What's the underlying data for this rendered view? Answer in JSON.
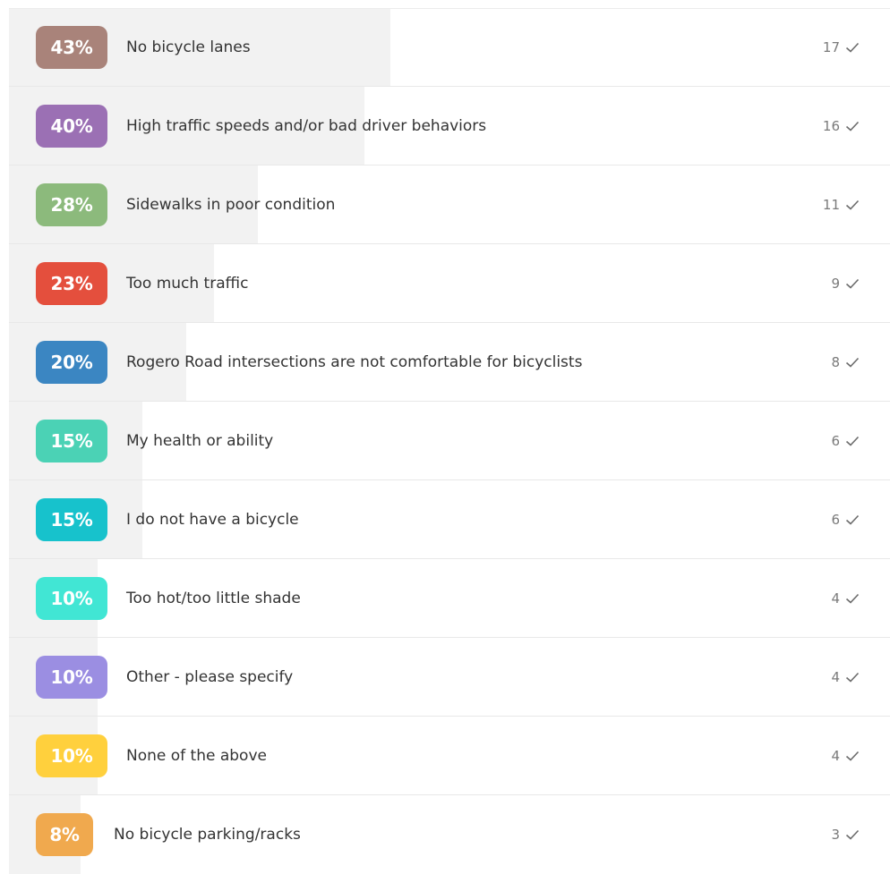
{
  "results": {
    "fill_color": "#f2f2f2",
    "items": [
      {
        "percent": "43%",
        "percent_value": 43,
        "label": "No bicycle lanes",
        "count": "17",
        "color": "#a9837a",
        "icon": "check-icon"
      },
      {
        "percent": "40%",
        "percent_value": 40,
        "label": "High traffic speeds and/or bad driver behaviors",
        "count": "16",
        "color": "#9b70b4",
        "icon": "check-icon"
      },
      {
        "percent": "28%",
        "percent_value": 28,
        "label": "Sidewalks in poor condition",
        "count": "11",
        "color": "#8cba7c",
        "icon": "check-icon"
      },
      {
        "percent": "23%",
        "percent_value": 23,
        "label": "Too much traffic",
        "count": "9",
        "color": "#e44f3d",
        "icon": "check-icon"
      },
      {
        "percent": "20%",
        "percent_value": 20,
        "label": "Rogero Road intersections are not comfortable for bicyclists",
        "count": "8",
        "color": "#3b86c2",
        "icon": "check-icon"
      },
      {
        "percent": "15%",
        "percent_value": 15,
        "label": "My health or ability",
        "count": "6",
        "color": "#4bd2b5",
        "icon": "check-icon"
      },
      {
        "percent": "15%",
        "percent_value": 15,
        "label": "I do not have a bicycle",
        "count": "6",
        "color": "#17c2cc",
        "icon": "check-icon"
      },
      {
        "percent": "10%",
        "percent_value": 10,
        "label": "Too hot/too little shade",
        "count": "4",
        "color": "#41e6d4",
        "icon": "check-icon"
      },
      {
        "percent": "10%",
        "percent_value": 10,
        "label": "Other - please specify",
        "count": "4",
        "color": "#9b8ee2",
        "icon": "check-icon"
      },
      {
        "percent": "10%",
        "percent_value": 10,
        "label": "None of the above",
        "count": "4",
        "color": "#ffd03d",
        "icon": "check-icon"
      },
      {
        "percent": "8%",
        "percent_value": 8,
        "label": "No bicycle parking/racks",
        "count": "3",
        "color": "#f0a94e",
        "icon": "check-icon"
      }
    ]
  }
}
